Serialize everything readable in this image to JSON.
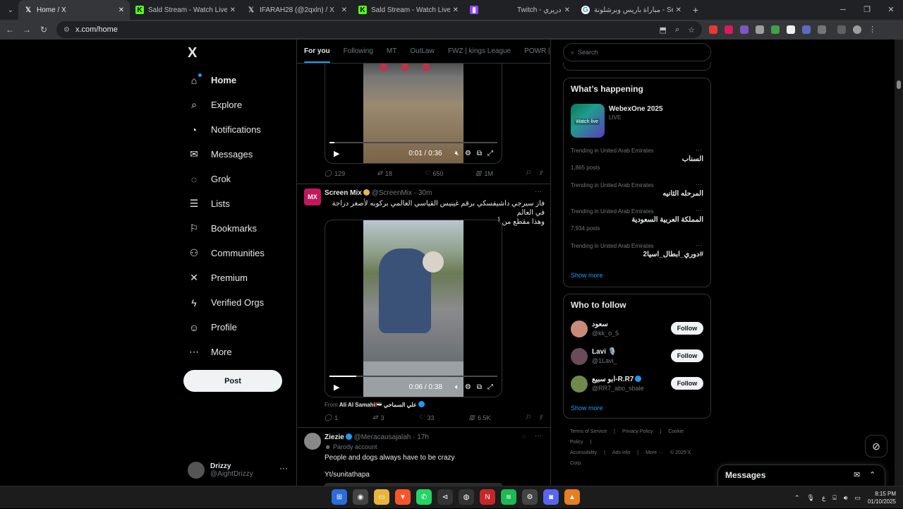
{
  "browser": {
    "tabs": [
      {
        "title": "Home / X",
        "icon": "x-icon",
        "active": true
      },
      {
        "title": "Sald Stream - Watch Live on Ki",
        "icon": "kick-icon"
      },
      {
        "title": "IFARAH28 (@2qxln) / X",
        "icon": "x-icon"
      },
      {
        "title": "Sald Stream - Watch Live on Ki",
        "icon": "kick-icon"
      },
      {
        "title": "Twitch - دريري",
        "icon": "twitch-icon"
      },
      {
        "title": "مباراة باريس وبرشلونة - Search",
        "icon": "google-icon"
      }
    ],
    "url": "x.com/home"
  },
  "nav": {
    "logo": "X",
    "items": [
      {
        "label": "Home",
        "icon": "home-icon",
        "glyph": "⌂"
      },
      {
        "label": "Explore",
        "icon": "search-icon",
        "glyph": "⌕"
      },
      {
        "label": "Notifications",
        "icon": "bell-icon",
        "glyph": "🔔"
      },
      {
        "label": "Messages",
        "icon": "envelope-icon",
        "glyph": "✉"
      },
      {
        "label": "Grok",
        "icon": "grok-icon",
        "glyph": "◌"
      },
      {
        "label": "Lists",
        "icon": "list-icon",
        "glyph": "☰"
      },
      {
        "label": "Bookmarks",
        "icon": "bookmark-icon",
        "glyph": "⚐"
      },
      {
        "label": "Communities",
        "icon": "people-icon",
        "glyph": "⚇"
      },
      {
        "label": "Premium",
        "icon": "x-premium-icon",
        "glyph": "✕"
      },
      {
        "label": "Verified Orgs",
        "icon": "lightning-icon",
        "glyph": "ϟ"
      },
      {
        "label": "Profile",
        "icon": "person-icon",
        "glyph": "☺"
      },
      {
        "label": "More",
        "icon": "more-circle-icon",
        "glyph": "⋯"
      }
    ],
    "post_label": "Post",
    "account": {
      "name": "Drizzy",
      "handle": "@AightDrizzy"
    }
  },
  "timeline": {
    "tabs": [
      "For you",
      "Following",
      "MT",
      "OutLaw",
      "FWZ | kings League",
      "POWR | ور"
    ],
    "tweet1": {
      "time": "0:01 / 0:36",
      "progress": 0.03,
      "replies": "129",
      "reposts": "18",
      "likes": "650",
      "views": "1M"
    },
    "tweet2": {
      "name": "Screen Mix",
      "handle": "@ScreenMix",
      "age": "· 30m",
      "avatar_text": "MX",
      "text_line1": "فاز سيرجي داشيفسكي برقم غينيس القياسي العالمي بركوبه لأصغر دراجة  في العالم",
      "text_line2": "وهذا مقطع من أحد عروضه",
      "time": "0:06 / 0:38",
      "progress": 0.16,
      "from_label": "From",
      "from_name": "Ali Al Samahi🇦🇪 علي السماحي",
      "replies": "1",
      "reposts": "3",
      "likes": "33",
      "views": "6.5K"
    },
    "tweet3": {
      "name": "Ziezie",
      "handle": "@Meracausajalah",
      "age": "· 17h",
      "parody": "Parody account",
      "text": "People and dogs always have to be crazy",
      "text2": "Yt/sunitathapa"
    }
  },
  "sidebar": {
    "search_placeholder": "Search",
    "happening_title": "What’s happening",
    "event": {
      "title": "WebexOne 2025",
      "status": "LIVE",
      "badge": "Watch live"
    },
    "trends": [
      {
        "context": "Trending in United Arab Emirates",
        "title": "السناب",
        "count": "1,865 posts"
      },
      {
        "context": "Trending in United Arab Emirates",
        "title": "المرحله الثانيه",
        "count": ""
      },
      {
        "context": "Trending in United Arab Emirates",
        "title": "المملكة العربية السعودية",
        "count": "7,934 posts"
      },
      {
        "context": "Trending in United Arab Emirates",
        "title": "#دوري_ابطال_اسيا2",
        "count": ""
      }
    ],
    "show_more": "Show more",
    "who_title": "Who to follow",
    "who": [
      {
        "name": "سعود",
        "handle": "@kk_o_5"
      },
      {
        "name": "Lavi 🎙️",
        "handle": "@1Lavi_"
      },
      {
        "name": "ابو سبيع-R.R7",
        "handle": "@RR7_abo_sbale"
      }
    ],
    "follow_label": "Follow",
    "footer": [
      "Terms of Service",
      "|",
      "Privacy Policy",
      "|",
      "Cookie Policy",
      "|",
      "Accessibility",
      "|",
      "Ads info",
      "|",
      "More ···",
      "© 2025 X Corp."
    ]
  },
  "messages_drawer": {
    "title": "Messages"
  },
  "taskbar": {
    "time": "8:15 PM",
    "date": "01/10/2025",
    "lang": "ع"
  },
  "colors": {
    "accent": "#1d9bf0",
    "bg": "#000000",
    "border": "#2f3336",
    "muted": "#71767b"
  }
}
